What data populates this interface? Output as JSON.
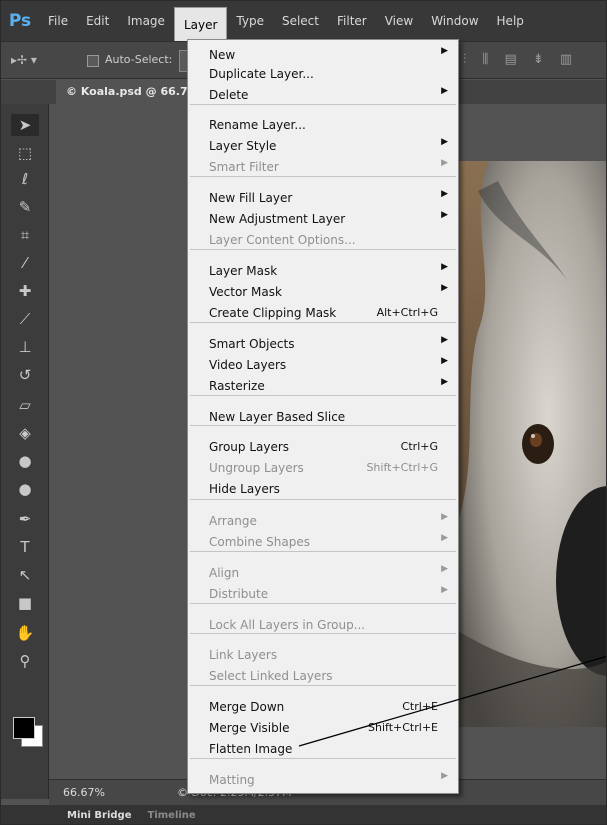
{
  "app": {
    "logo": "Ps",
    "menus": [
      "File",
      "Edit",
      "Image",
      "Layer",
      "Type",
      "Select",
      "Filter",
      "View",
      "Window",
      "Help"
    ],
    "active_menu": "Layer"
  },
  "options_bar": {
    "auto_select_label": "Auto-Select:"
  },
  "document_tab": {
    "title": "© Koala.psd @ 66.7%"
  },
  "status_bar": {
    "zoom": "66.67%",
    "doc_info": "© Doc: 2.25M/2.57M"
  },
  "bottom_tabs": [
    "Mini Bridge",
    "Timeline"
  ],
  "layer_menu": {
    "items": [
      {
        "label": "New",
        "submenu": true
      },
      {
        "label": "Duplicate Layer..."
      },
      {
        "label": "Delete",
        "submenu": true
      },
      {
        "label": "Rename Layer..."
      },
      {
        "label": "Layer Style",
        "submenu": true
      },
      {
        "label": "Smart Filter",
        "submenu": true,
        "disabled": true
      },
      {
        "label": "New Fill Layer",
        "submenu": true
      },
      {
        "label": "New Adjustment Layer",
        "submenu": true
      },
      {
        "label": "Layer Content Options...",
        "disabled": true
      },
      {
        "label": "Layer Mask",
        "submenu": true
      },
      {
        "label": "Vector Mask",
        "submenu": true
      },
      {
        "label": "Create Clipping Mask",
        "shortcut": "Alt+Ctrl+G"
      },
      {
        "label": "Smart Objects",
        "submenu": true
      },
      {
        "label": "Video Layers",
        "submenu": true
      },
      {
        "label": "Rasterize",
        "submenu": true
      },
      {
        "label": "New Layer Based Slice"
      },
      {
        "label": "Group Layers",
        "shortcut": "Ctrl+G"
      },
      {
        "label": "Ungroup Layers",
        "shortcut": "Shift+Ctrl+G",
        "disabled": true
      },
      {
        "label": "Hide Layers"
      },
      {
        "label": "Arrange",
        "submenu": true,
        "disabled": true
      },
      {
        "label": "Combine Shapes",
        "submenu": true,
        "disabled": true
      },
      {
        "label": "Align",
        "submenu": true,
        "disabled": true
      },
      {
        "label": "Distribute",
        "submenu": true,
        "disabled": true
      },
      {
        "label": "Lock All Layers in Group...",
        "disabled": true
      },
      {
        "label": "Link Layers",
        "disabled": true
      },
      {
        "label": "Select Linked Layers",
        "disabled": true
      },
      {
        "label": "Merge Down",
        "shortcut": "Ctrl+E"
      },
      {
        "label": "Merge Visible",
        "shortcut": "Shift+Ctrl+E"
      },
      {
        "label": "Flatten Image"
      },
      {
        "label": "Matting",
        "submenu": true,
        "disabled": true
      }
    ]
  },
  "tools": [
    {
      "icon": "move-tool-icon",
      "glyph": "➤"
    },
    {
      "icon": "marquee-tool-icon",
      "glyph": "⬚"
    },
    {
      "icon": "lasso-tool-icon",
      "glyph": "ℓ"
    },
    {
      "icon": "quick-select-tool-icon",
      "glyph": "✎"
    },
    {
      "icon": "crop-tool-icon",
      "glyph": "⌗"
    },
    {
      "icon": "eyedropper-tool-icon",
      "glyph": "⁄"
    },
    {
      "icon": "healing-brush-tool-icon",
      "glyph": "✚"
    },
    {
      "icon": "brush-tool-icon",
      "glyph": "⟋"
    },
    {
      "icon": "clone-stamp-tool-icon",
      "glyph": "⊥"
    },
    {
      "icon": "history-brush-tool-icon",
      "glyph": "↺"
    },
    {
      "icon": "eraser-tool-icon",
      "glyph": "▱"
    },
    {
      "icon": "paint-bucket-tool-icon",
      "glyph": "◈"
    },
    {
      "icon": "blur-tool-icon",
      "glyph": "●"
    },
    {
      "icon": "dodge-tool-icon",
      "glyph": "●"
    },
    {
      "icon": "pen-tool-icon",
      "glyph": "✒"
    },
    {
      "icon": "type-tool-icon",
      "glyph": "T"
    },
    {
      "icon": "path-select-tool-icon",
      "glyph": "↖"
    },
    {
      "icon": "shape-tool-icon",
      "glyph": "■"
    },
    {
      "icon": "hand-tool-icon",
      "glyph": "✋"
    },
    {
      "icon": "zoom-tool-icon",
      "glyph": "⚲"
    }
  ],
  "colors": {
    "menubar": "#383838",
    "workspace": "#535353",
    "menu_bg": "#f0f0f0",
    "disabled_text": "#8f8f8f",
    "ps_blue": "#5ab1f0"
  }
}
